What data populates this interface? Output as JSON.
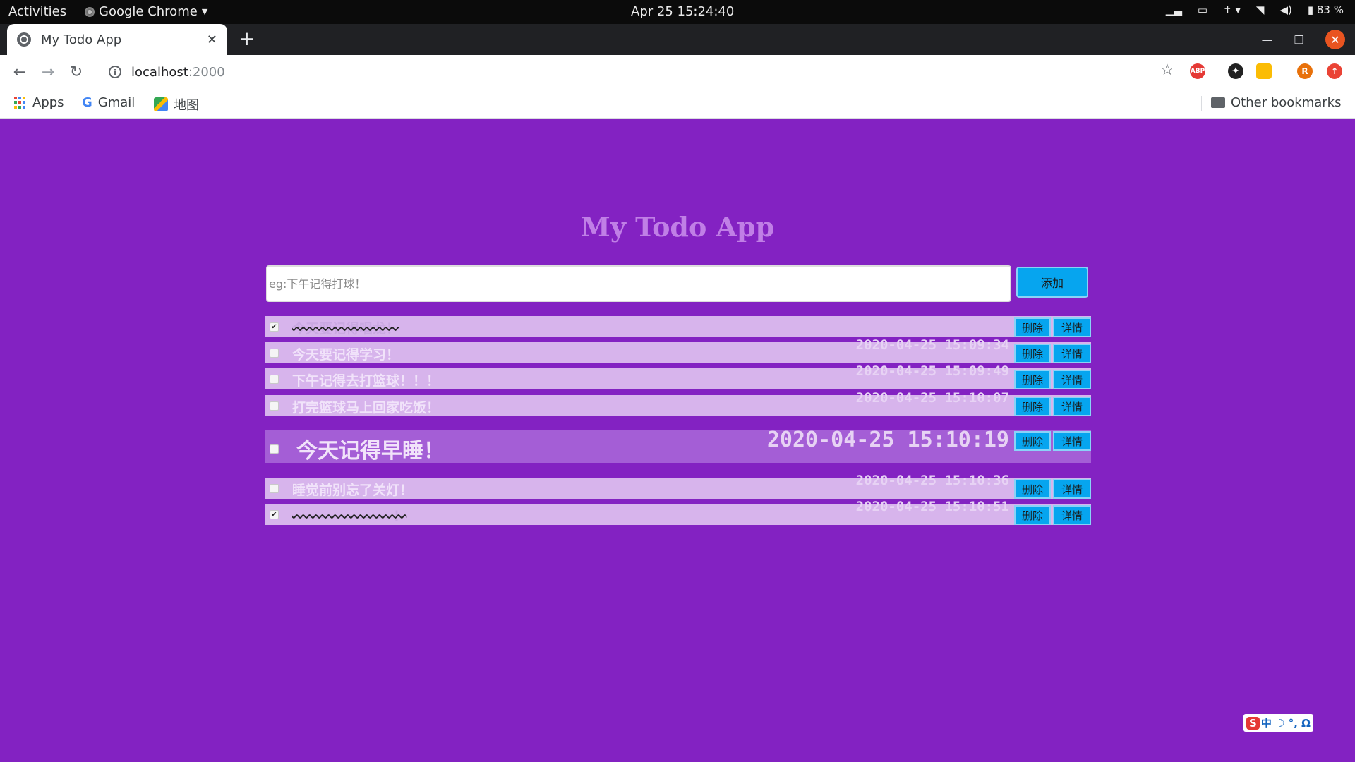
{
  "system_bar": {
    "activities": "Activities",
    "app_name": "Google Chrome",
    "datetime": "Apr 25  15:24:40",
    "battery": "83 %"
  },
  "browser": {
    "tab_title": "My Todo App",
    "url_host": "localhost",
    "url_port": ":2000",
    "bookmarks": [
      "Apps",
      "Gmail",
      "地图"
    ],
    "other_bookmarks": "Other bookmarks",
    "extensions": [
      "ABP",
      "R"
    ]
  },
  "app": {
    "title": "My Todo App",
    "input_placeholder": "eg:下午记得打球！",
    "add_label": "添加",
    "delete_label": "删除",
    "detail_label": "详情",
    "todos": [
      {
        "text": "今天要记得唱龙！",
        "time": "",
        "checked": true,
        "done": true,
        "big": false
      },
      {
        "text": "今天要记得学习！",
        "time": "2020-04-25 15:09:34",
        "checked": false,
        "done": false,
        "big": false
      },
      {
        "text": "下午记得去打篮球！！！",
        "time": "2020-04-25 15:09:49",
        "checked": false,
        "done": false,
        "big": false
      },
      {
        "text": "打完篮球马上回家吃饭！",
        "time": "2020-04-25 15:10:07",
        "checked": false,
        "done": false,
        "big": false
      },
      {
        "text": "今天记得早睡！",
        "time": "2020-04-25 15:10:19",
        "checked": false,
        "done": false,
        "big": true
      },
      {
        "text": "睡觉前别忘了关灯！",
        "time": "2020-04-25 15:10:36",
        "checked": false,
        "done": false,
        "big": false
      },
      {
        "text": "~~~~~~~~~！",
        "time": "2020-04-25 15:10:51",
        "checked": true,
        "done": true,
        "big": false
      }
    ]
  },
  "ime": {
    "labels": "中 ☽ °, Ω"
  }
}
